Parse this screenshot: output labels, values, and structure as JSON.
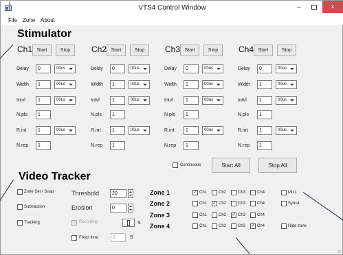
{
  "window": {
    "title": "VTS4 Control Window",
    "minimize": "–",
    "close": "×"
  },
  "menu": [
    "File",
    "Zone",
    "About"
  ],
  "stimulator": {
    "heading": "Stimulator",
    "start_label": "Start",
    "stop_label": "Stop",
    "row_labels": [
      "Delay",
      "Width",
      "Intvl",
      "N.pls",
      "R.int",
      "N.rep"
    ],
    "channels": [
      {
        "name": "Ch1",
        "delay": "0",
        "delay_unit": "00us",
        "width": "1",
        "width_unit": "00us",
        "intvl": "1",
        "intvl_unit": "00us",
        "npls": "1",
        "rint": "1",
        "rint_unit": "00us",
        "nrep": "1"
      },
      {
        "name": "Ch2",
        "delay": "0",
        "delay_unit": "00us",
        "width": "1",
        "width_unit": "00us",
        "intvl": "1",
        "intvl_unit": "00us",
        "npls": "1",
        "rint": "1",
        "rint_unit": "00us",
        "nrep": "1"
      },
      {
        "name": "Ch3",
        "delay": "0",
        "delay_unit": "00us",
        "width": "1",
        "width_unit": "00us",
        "intvl": "1",
        "intvl_unit": "00us",
        "npls": "1",
        "rint": "1",
        "rint_unit": "00us",
        "nrep": "1"
      },
      {
        "name": "Ch4",
        "delay": "0",
        "delay_unit": "00us",
        "width": "1",
        "width_unit": "00us",
        "intvl": "1",
        "intvl_unit": "00us",
        "npls": "1",
        "rint": "1",
        "rint_unit": "00us",
        "nrep": "1"
      }
    ],
    "continuous_label": "Continuous",
    "continuous_checked": false,
    "start_all_label": "Start All",
    "stop_all_label": "Stop All"
  },
  "video_tracker": {
    "heading": "Video Tracker",
    "zone_set_label": "Zone Set / Snap",
    "subtraction_label": "Subtraction",
    "tracking_label": "Tracking",
    "threshold_label": "Threshold",
    "threshold_value": "20",
    "erosion_label": "Erosion",
    "erosion_value": "0",
    "recording_label": "Recording",
    "seconds_unit": "S",
    "fixed_time_label": "Fixed time",
    "fixed_time_value": "1",
    "fixed_time_unit": "S",
    "zones": [
      {
        "label": "Zone 1",
        "checks": [
          true,
          false,
          false,
          false
        ]
      },
      {
        "label": "Zone 2",
        "checks": [
          false,
          true,
          false,
          false
        ]
      },
      {
        "label": "Zone 3",
        "checks": [
          false,
          false,
          true,
          false
        ]
      },
      {
        "label": "Zone 4",
        "checks": [
          false,
          false,
          false,
          true
        ]
      }
    ],
    "zone_channel_labels": [
      "Ch1",
      "Ch2",
      "Ch3",
      "Ch4"
    ],
    "mix_label": "Mix1",
    "sync_label": "Sync4",
    "hide_zone_label": "Hide zone"
  },
  "colors": {
    "close_button": "#c75050",
    "window_bg": "#f0f0f0"
  },
  "icons": [
    "app-icon",
    "minimize-icon",
    "maximize-icon",
    "close-icon",
    "resize-grip-icon"
  ]
}
